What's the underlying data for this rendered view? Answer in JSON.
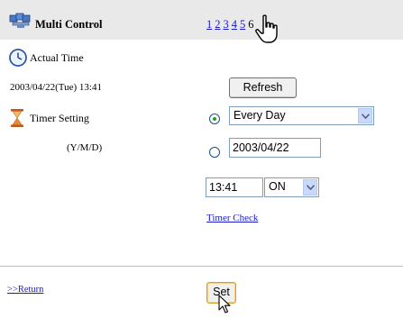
{
  "header": {
    "title": "Multi Control",
    "pages": [
      {
        "label": "1",
        "current": false
      },
      {
        "label": "2",
        "current": false
      },
      {
        "label": "3",
        "current": false
      },
      {
        "label": "4",
        "current": false
      },
      {
        "label": "5",
        "current": false
      },
      {
        "label": "6",
        "current": true
      }
    ]
  },
  "actual_time": {
    "label": "Actual Time",
    "value": "2003/04/22(Tue) 13:41",
    "refresh_label": "Refresh"
  },
  "timer_setting": {
    "label": "Timer Setting",
    "date_format_label": "(Y/M/D)",
    "repeat_option": {
      "selected": true,
      "value": "Every Day"
    },
    "date_option": {
      "selected": false,
      "value": "2003/04/22"
    },
    "time_value": "13:41",
    "state_value": "ON",
    "timer_check_label": "Timer Check"
  },
  "footer": {
    "return_label": ">>Return",
    "set_label": "Set"
  },
  "colors": {
    "header_bg": "#e9e9e9",
    "link": "#1a1acc",
    "divider": "#c7c2a6"
  }
}
